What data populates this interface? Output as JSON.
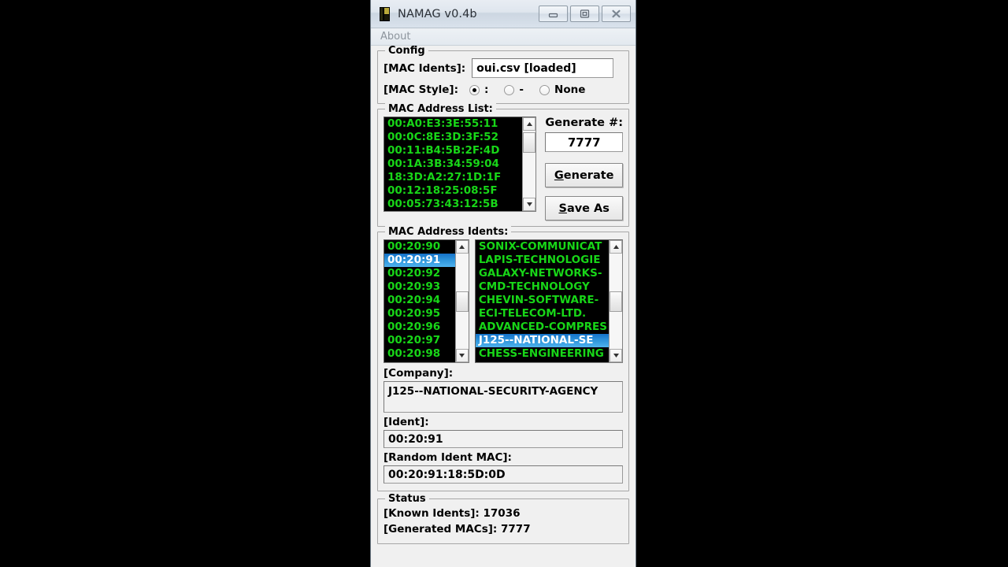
{
  "window": {
    "title": "NAMAG v0.4b",
    "icon": "app-icon",
    "buttons": {
      "minimize": "minimize-icon",
      "maximize": "maximize-icon",
      "close": "close-icon"
    }
  },
  "menubar": {
    "items": [
      {
        "label": "About"
      }
    ]
  },
  "config": {
    "title": "Config",
    "mac_idents_label": "[MAC Idents]:",
    "mac_idents_value": "oui.csv [loaded]",
    "mac_style_label": "[MAC Style]:",
    "mac_style_options": [
      {
        "label": ":",
        "checked": true
      },
      {
        "label": "-",
        "checked": false
      },
      {
        "label": "None",
        "checked": false
      }
    ]
  },
  "mac_address_list": {
    "title": "MAC Address List:",
    "rows": [
      "00:A0:E3:3E:55:11",
      "00:0C:8E:3D:3F:52",
      "00:11:B4:5B:2F:4D",
      "00:1A:3B:34:59:04",
      "18:3D:A2:27:1D:1F",
      "00:12:18:25:08:5F",
      "00:05:73:43:12:5B"
    ],
    "generate_label": "Generate #:",
    "generate_count": "7777",
    "generate_button": "Generate",
    "generate_button_accel": "G",
    "save_as_button": "Save As",
    "save_as_accel": "S"
  },
  "mac_address_idents": {
    "title": "MAC Address Idents:",
    "idents": [
      {
        "value": "00:20:90",
        "selected": false
      },
      {
        "value": "00:20:91",
        "selected": true
      },
      {
        "value": "00:20:92",
        "selected": false
      },
      {
        "value": "00:20:93",
        "selected": false
      },
      {
        "value": "00:20:94",
        "selected": false
      },
      {
        "value": "00:20:95",
        "selected": false
      },
      {
        "value": "00:20:96",
        "selected": false
      },
      {
        "value": "00:20:97",
        "selected": false
      },
      {
        "value": "00:20:98",
        "selected": false
      }
    ],
    "companies": [
      {
        "value": "SONIX-COMMUNICAT",
        "selected": false
      },
      {
        "value": "LAPIS-TECHNOLOGIE",
        "selected": false
      },
      {
        "value": "GALAXY-NETWORKS-",
        "selected": false
      },
      {
        "value": "CMD-TECHNOLOGY",
        "selected": false
      },
      {
        "value": "CHEVIN-SOFTWARE-",
        "selected": false
      },
      {
        "value": "ECI-TELECOM-LTD.",
        "selected": false
      },
      {
        "value": "ADVANCED-COMPRES",
        "selected": false
      },
      {
        "value": "J125--NATIONAL-SE",
        "selected": true
      },
      {
        "value": "CHESS-ENGINEERING",
        "selected": false
      }
    ]
  },
  "details": {
    "company_label": "[Company]:",
    "company_value": "J125--NATIONAL-SECURITY-AGENCY",
    "ident_label": "[Ident]:",
    "ident_value": "00:20:91",
    "random_ident_mac_label": "[Random Ident MAC]:",
    "random_ident_mac_value": "00:20:91:18:5D:0D"
  },
  "status": {
    "title": "Status",
    "known_idents": "[Known Idents]: 17036",
    "generated_macs": "[Generated MACs]: 7777"
  },
  "colors": {
    "terminal_bg": "#000000",
    "terminal_fg": "#18d618",
    "selection_blue": "#2f96dc",
    "window_bg": "#f0f0f0"
  }
}
